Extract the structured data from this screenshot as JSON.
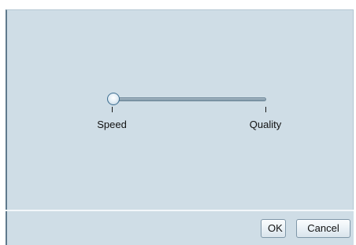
{
  "dialog": {
    "slider": {
      "min_label": "Speed",
      "max_label": "Quality",
      "value": 0.0
    },
    "buttons": {
      "ok_label": "OK",
      "cancel_label": "Cancel"
    }
  }
}
